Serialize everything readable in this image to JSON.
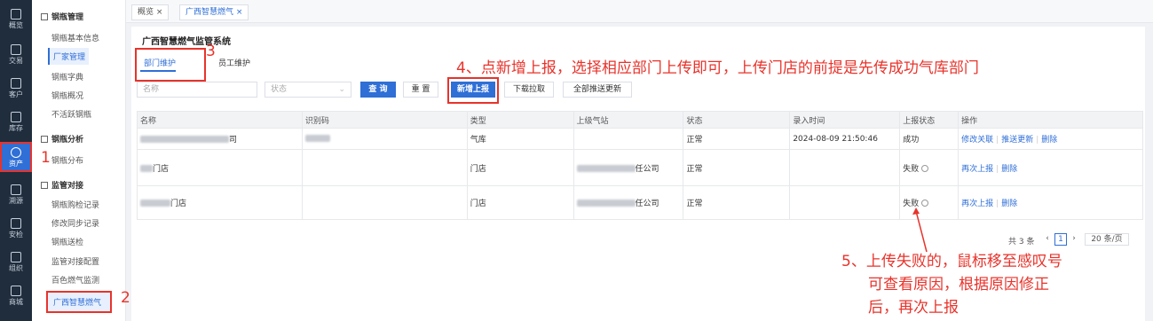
{
  "rail": [
    {
      "label": "概览",
      "icon": "dashboard-icon"
    },
    {
      "label": "交易",
      "icon": "trade-icon"
    },
    {
      "label": "客户",
      "icon": "customer-icon"
    },
    {
      "label": "库存",
      "icon": "inventory-icon"
    },
    {
      "label": "资产",
      "icon": "asset-icon",
      "active": true
    },
    {
      "label": "溯源",
      "icon": "trace-icon"
    },
    {
      "label": "安检",
      "icon": "safety-icon"
    },
    {
      "label": "组织",
      "icon": "org-icon"
    },
    {
      "label": "商城",
      "icon": "mall-icon"
    }
  ],
  "sidebar": {
    "group1": "钢瓶管理",
    "items1": [
      "钢瓶基本信息",
      "厂家管理",
      "钢瓶字典",
      "钢瓶概况",
      "不活跃钢瓶"
    ],
    "group2": "钢瓶分析",
    "items2": [
      "钢瓶分布"
    ],
    "group3": "监管对接",
    "items3": [
      "钢瓶购检记录",
      "修改同步记录",
      "钢瓶送检",
      "监管对接配置",
      "百色燃气监测",
      "广西智慧燃气"
    ]
  },
  "page_tabs": [
    "概览 ×",
    "广西智慧燃气 ×"
  ],
  "page_title": "广西智慧燃气监管系统",
  "sub_tabs": [
    "部门维护",
    "员工维护"
  ],
  "filters": {
    "name_placeholder": "名称",
    "status_placeholder": "状态"
  },
  "buttons": {
    "query": "查 询",
    "reset": "重 置",
    "new_report": "新增上报",
    "download": "下载拉取",
    "push_all": "全部推送更新"
  },
  "table": {
    "headers": [
      "名称",
      "识别码",
      "类型",
      "上级气站",
      "状态",
      "录入时间",
      "上报状态",
      "操作"
    ],
    "rows": [
      {
        "name": "司",
        "code": "",
        "type": "气库",
        "parent": "",
        "status": "正常",
        "time": "2024-08-09 21:50:46",
        "report": "成功",
        "actions": [
          "修改关联",
          "推送更新",
          "删除"
        ]
      },
      {
        "name": "门店",
        "code": "",
        "type": "门店",
        "parent": "任公司",
        "status": "正常",
        "time": "",
        "report": "失败",
        "actions": [
          "再次上报",
          "删除"
        ]
      },
      {
        "name": "门店",
        "code": "",
        "type": "门店",
        "parent": "任公司",
        "status": "正常",
        "time": "",
        "report": "失败",
        "actions": [
          "再次上报",
          "删除"
        ]
      }
    ]
  },
  "pager": {
    "total": "共 3 条",
    "page": "1",
    "size": "20 条/页"
  },
  "annotations": {
    "n1": "1",
    "n2": "2",
    "n3": "3",
    "note4": "4、点新增上报，选择相应部门上传即可，上传门店的前提是先传成功气库部门",
    "note5_l1": "5、上传失败的，鼠标移至感叹号",
    "note5_l2": "可查看原因，根据原因修正",
    "note5_l3": "后，再次上报"
  },
  "colors": {
    "primary": "#2f6fd6",
    "annotation": "#e8332b",
    "rail": "#1f2d3d"
  }
}
